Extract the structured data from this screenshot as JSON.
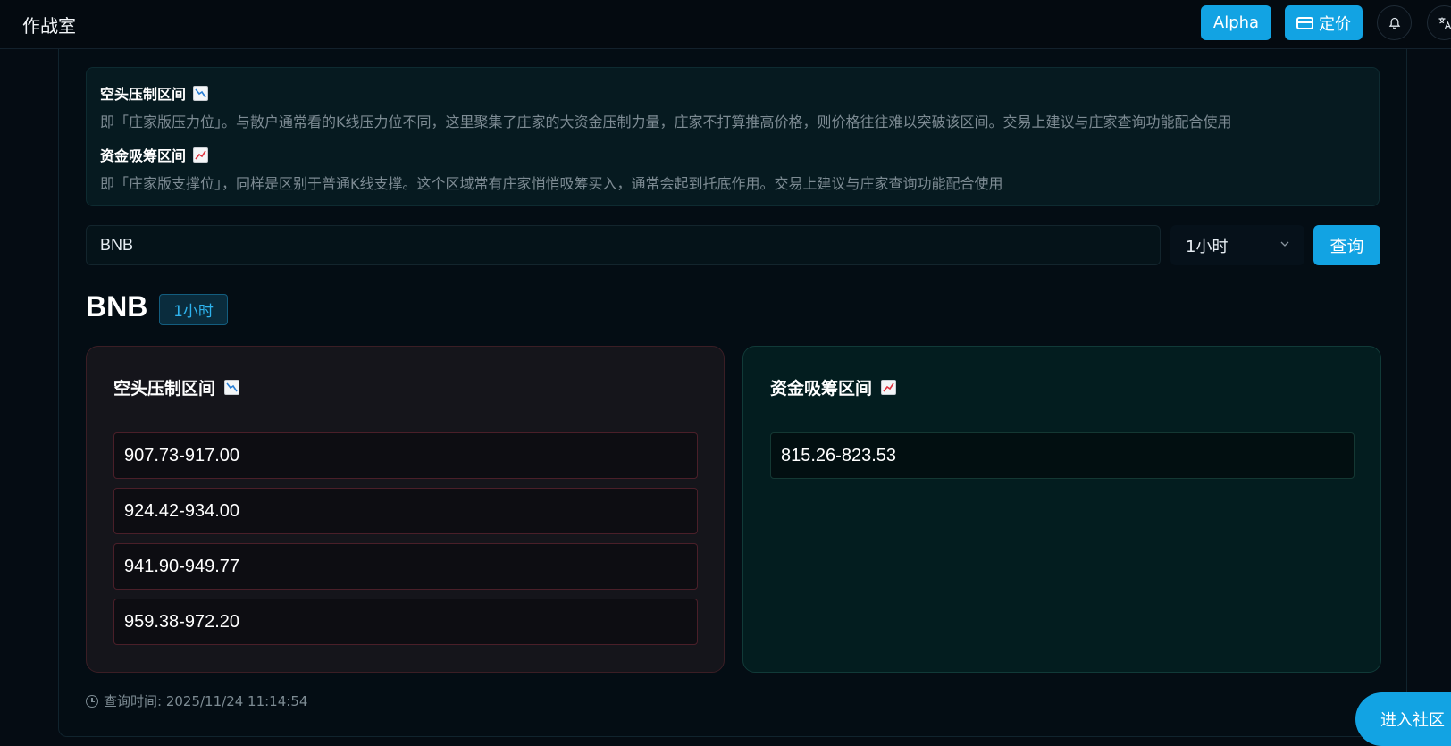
{
  "header": {
    "title": "作战室",
    "alpha_label": "Alpha",
    "pricing_label": "定价",
    "icons": [
      "card-icon",
      "bell-icon",
      "translate-icon"
    ]
  },
  "info": {
    "short_title": "空头压制区间",
    "short_desc": "即「庄家版压力位」。与散户通常看的K线压力位不同，这里聚集了庄家的大资金压制力量，庄家不打算推高价格，则价格往往难以突破该区间。交易上建议与庄家查询功能配合使用",
    "long_title": "资金吸筹区间",
    "long_desc": "即「庄家版支撑位」，同样是区别于普通K线支撑。这个区域常有庄家悄悄吸筹买入，通常会起到托底作用。交易上建议与庄家查询功能配合使用"
  },
  "search": {
    "value": "BNB",
    "interval": "1小时",
    "query_label": "查询"
  },
  "result": {
    "symbol": "BNB",
    "interval_badge": "1小时",
    "short_panel": {
      "title": "空头压制区间",
      "ranges": [
        "907.73-917.00",
        "924.42-934.00",
        "941.90-949.77",
        "959.38-972.20"
      ]
    },
    "long_panel": {
      "title": "资金吸筹区间",
      "ranges": [
        "815.26-823.53"
      ]
    },
    "query_time": "查询时间: 2025/11/24 11:14:54"
  },
  "community_label": "进入社区",
  "colors": {
    "accent": "#12a3e3",
    "short_border": "#4a1f29",
    "long_border": "#143833"
  }
}
